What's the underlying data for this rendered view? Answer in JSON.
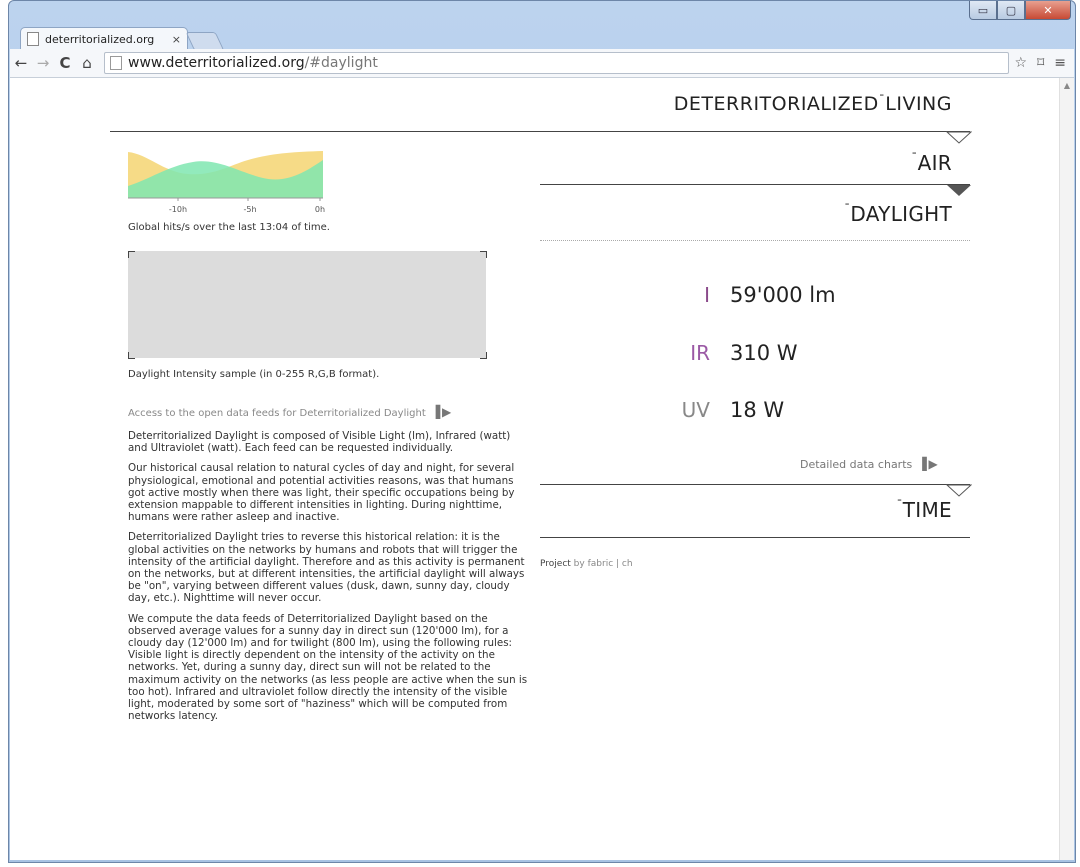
{
  "browser": {
    "tab_title": "deterritorialized.org",
    "tab_close": "×",
    "url_host": "www.deterritorialized.org",
    "url_path": "/#daylight",
    "win_min": "▭",
    "win_max": "▢",
    "win_close": "✕",
    "back_glyph": "←",
    "forward_glyph": "→",
    "reload_glyph": "C",
    "home_glyph": "⌂",
    "star_glyph": "☆",
    "cast_glyph": "⌑",
    "menu_glyph": "≡"
  },
  "header": {
    "title_a": "DETERRITORIALIZED",
    "macron": "¯",
    "title_b": "LIVING"
  },
  "sections": {
    "air": "AIR",
    "daylight": "DAYLIGHT",
    "time": "TIME"
  },
  "readings": [
    {
      "label": "I",
      "value": "59'000 lm",
      "color": "#8a4a8a"
    },
    {
      "label": "IR",
      "value": "310 W",
      "color": "#9b59a5"
    },
    {
      "label": "UV",
      "value": "18 W",
      "color": "#888888"
    }
  ],
  "detailed_charts_link": "Detailed data charts",
  "project": {
    "prefix": "Project",
    "by": "by",
    "link": "fabric | ch"
  },
  "sparkline": {
    "ticks": [
      "-10h",
      "-5h",
      "0h"
    ],
    "caption": "Global hits/s over the last 13:04 of time.",
    "colors": {
      "yellow": "#f5d77a",
      "green": "#7fe6b0"
    }
  },
  "sample": {
    "caption": "Daylight Intensity sample (in 0-255 R,G,B format).",
    "fill": "#dcdcdc"
  },
  "feed_link": "Access to the open data feeds for Deterritorialized Daylight",
  "arrow_glyph": "▌▶",
  "paragraphs": [
    "Deterritorialized Daylight is composed of Visible Light (lm), Infrared (watt) and Ultraviolet (watt). Each feed can be requested individually.",
    "Our historical causal relation to natural cycles of day and night, for several physiological, emotional and potential activities reasons, was that humans got active mostly when there was light, their specific occupations being by extension mappable to different intensities in lighting. During nighttime, humans were rather asleep and inactive.",
    "Deterritorialized Daylight tries to reverse this historical relation: it is the global activities on the networks by humans and robots that will trigger the intensity of the artificial daylight. Therefore and as this activity is permanent on the networks, but at different intensities, the artificial daylight will always be \"on\", varying between different values (dusk, dawn, sunny day, cloudy day, etc.). Nighttime will never occur.",
    "We compute the data feeds of Deterritorialized Daylight based on the observed average values for a sunny day in direct sun (120'000 lm), for a cloudy day (12'000 lm) and for twilight (800 lm), using the following rules: Visible light is directly dependent on the intensity of the activity on the networks. Yet, during a sunny day, direct sun will not be related to the maximum activity on the networks (as less people are active when the sun is too hot). Infrared and ultraviolet follow directly the intensity of the visible light, moderated by some sort of \"haziness\" which will be computed from networks latency."
  ]
}
